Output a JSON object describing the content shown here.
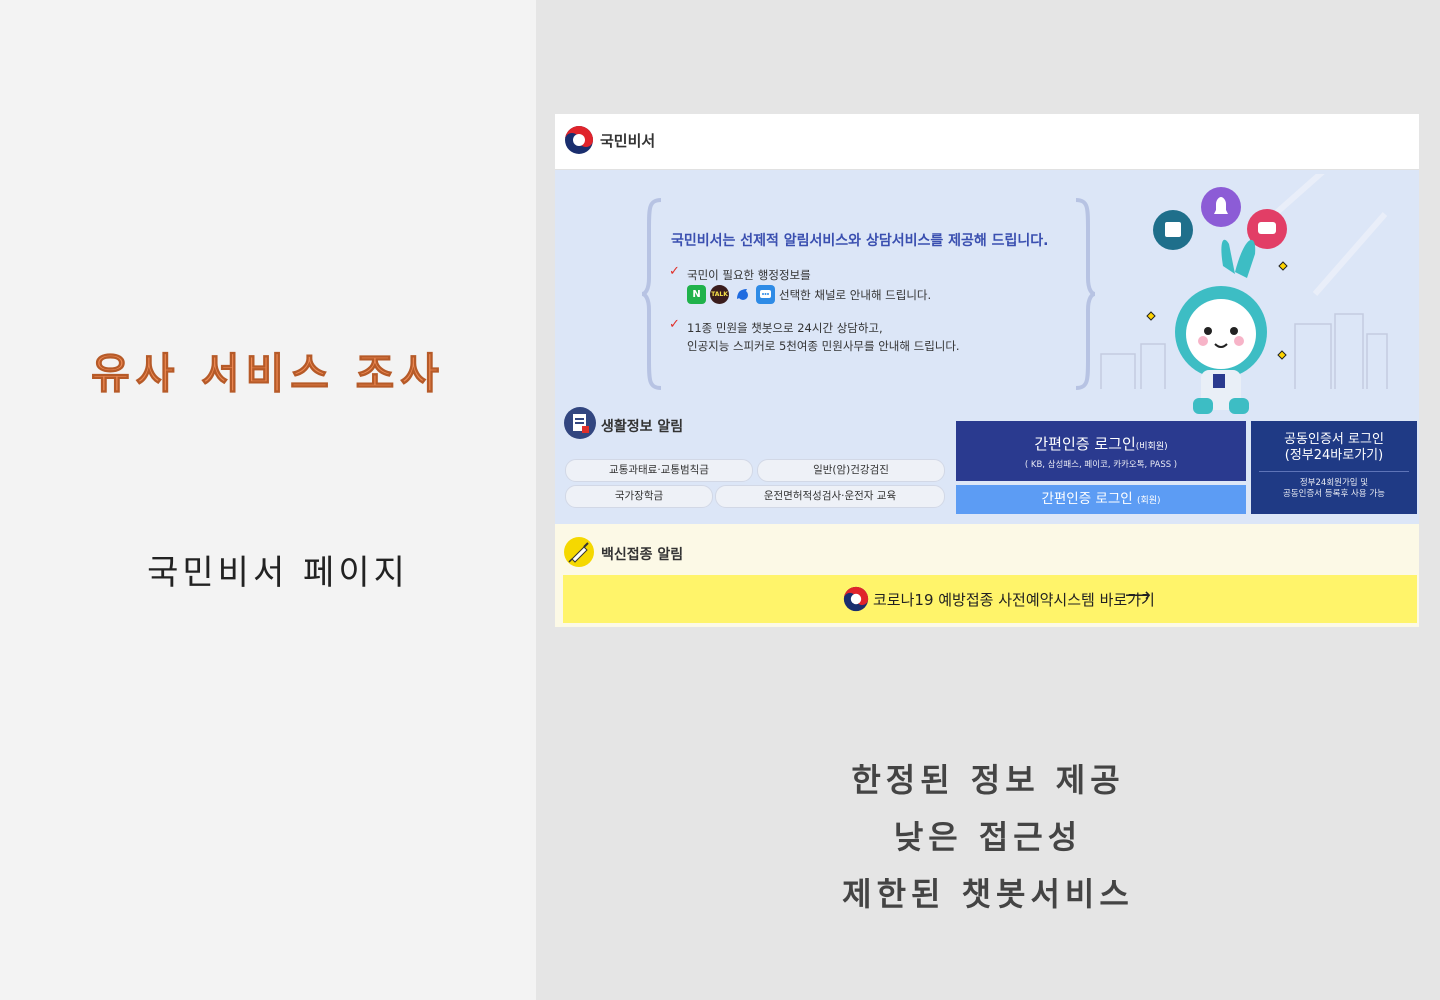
{
  "slide": {
    "title": "유사 서비스 조사",
    "subtitle": "국민비서 페이지",
    "notes": [
      "한정된 정보 제공",
      "낮은 접근성",
      "제한된 챗봇서비스"
    ]
  },
  "screenshot": {
    "brand": "국민비서",
    "intro": {
      "title": "국민비서는 선제적 알림서비스와 상담서비스를 제공해 드립니다.",
      "point1_line1": "국민이 필요한 행정정보를",
      "point1_line2": "선택한 채널로 안내해 드립니다.",
      "point2_line1": "11종 민원을 챗봇으로 24시간 상담하고,",
      "point2_line2": "인공지능 스피커로 5천여종 민원사무를 안내해 드립니다.",
      "channels": [
        "N",
        "TALK",
        "",
        ""
      ]
    },
    "life": {
      "title": "생활정보 알림",
      "items": [
        "교통과태료·교통범칙금",
        "일반(암)건강검진",
        "국가장학금",
        "운전면허적성검사·운전자 교육"
      ]
    },
    "login": {
      "simple_label": "간편인증 로그인",
      "simple_tag": "(비회원)",
      "simple_providers": "( KB, 삼성패스, 페이코, 카카오톡, PASS )",
      "member_label": "간편인증 로그인",
      "member_tag": "(회원)",
      "cert_line1": "공동인증서 로그인",
      "cert_line2": "(정부24바로가기)",
      "cert_note1": "정부24회원가입 및",
      "cert_note2": "공동인증서 등록후 사용 가능"
    },
    "vaccine": {
      "title": "백신접종 알림",
      "button_label": "코로나19 예방접종 사전예약시스템 바로가기",
      "arrow": "⟶"
    },
    "colors": {
      "title_orange": "#ee8a55",
      "header_navy": "#2a3a8f",
      "member_blue": "#5c9cf4",
      "vaccine_yellow": "#fff46a",
      "mascot_teal": "#3dbdc4"
    }
  }
}
